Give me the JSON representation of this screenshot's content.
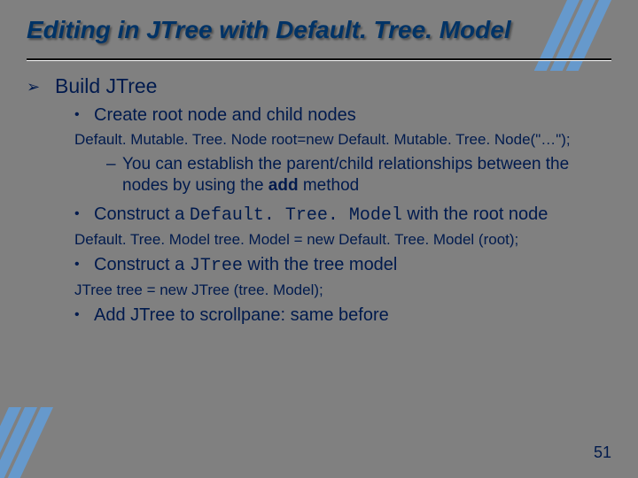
{
  "title": "Editing in JTree with Default. Tree. Model",
  "b1": "Build JTree",
  "b1_1": "Create root node and child nodes",
  "code1": "Default. Mutable. Tree. Node root=new Default. Mutable. Tree. Node(\"…\");",
  "sub1_pre": "You can establish the parent/child relationships between the nodes by using the ",
  "sub1_bold": "add",
  "sub1_post": " method",
  "b1_2_pre": "Construct a ",
  "b1_2_code": "Default. Tree. Model",
  "b1_2_post": " with the root node",
  "code2": "Default. Tree. Model tree. Model = new Default. Tree. Model (root);",
  "b1_3_pre": "Construct a ",
  "b1_3_code": "JTree",
  "b1_3_post": " with the tree model",
  "code3": "JTree tree = new JTree (tree. Model);",
  "b1_4": "Add JTree to scrollpane: same before",
  "page": "51"
}
